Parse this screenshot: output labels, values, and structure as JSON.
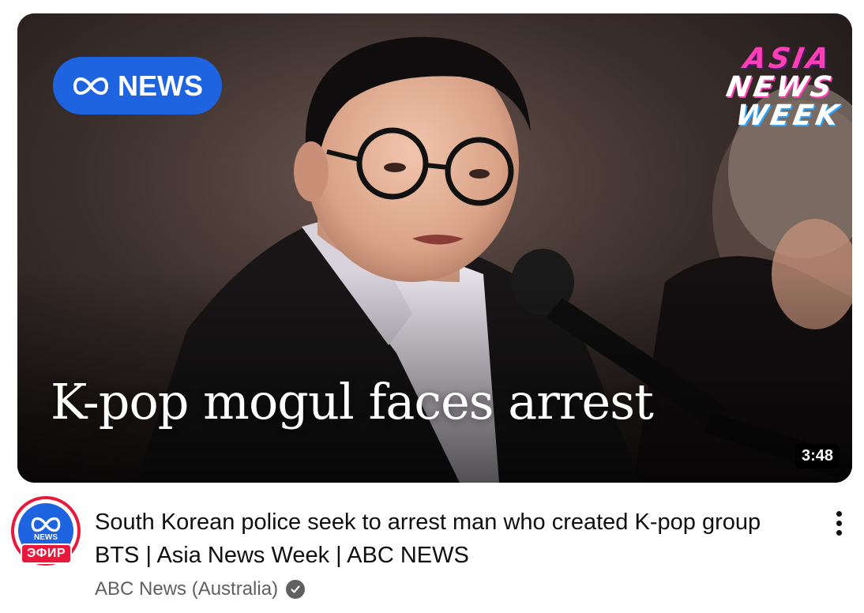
{
  "video": {
    "thumbnail": {
      "logo_text": "NEWS",
      "badge_lines": [
        "ASIA",
        "NEWS",
        "WEEK"
      ],
      "headline": "K-pop mogul faces arrest",
      "duration": "3:48"
    },
    "title": "South Korean police seek to arrest man who created K-pop group BTS | Asia News Week | ABC NEWS",
    "channel": {
      "name": "ABC News (Australia)",
      "verified": true,
      "live_badge": "ЭФИР",
      "avatar_sub": "NEWS"
    },
    "more_icon": "vertical-ellipsis-icon"
  },
  "colors": {
    "abc_blue": "#1e63e0",
    "live_red": "#e8193b",
    "badge_pink": "#ff3fb3"
  }
}
